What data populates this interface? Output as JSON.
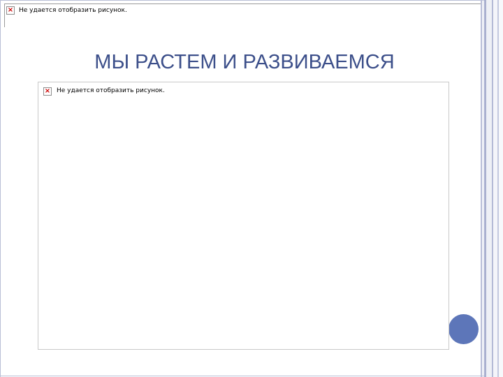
{
  "slide": {
    "title": "МЫ РАСТЕМ И РАЗВИВАЕМСЯ"
  },
  "header_image": {
    "broken_icon": "broken-image-icon",
    "message": "Не удается отобразить рисунок."
  },
  "main_image": {
    "broken_icon": "broken-image-icon",
    "message": "Не удается отобразить рисунок."
  },
  "colors": {
    "title": "#3c4f8a",
    "accent_circle": "#5d76b9",
    "frame": "#b9bfd6"
  }
}
